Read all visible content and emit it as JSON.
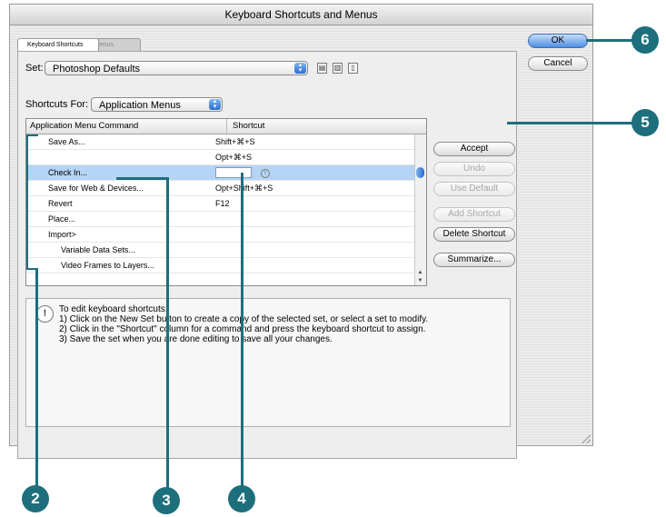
{
  "window": {
    "title": "Keyboard Shortcuts and Menus"
  },
  "tabs": [
    {
      "label": "Keyboard Shortcuts",
      "active": true
    },
    {
      "label": "Menus",
      "active": false
    }
  ],
  "set": {
    "label": "Set:",
    "value": "Photoshop Defaults"
  },
  "shortcuts_for": {
    "label": "Shortcuts For:",
    "value": "Application Menus"
  },
  "table": {
    "columns": [
      "Application Menu Command",
      "Shortcut"
    ],
    "rows": [
      {
        "command": "Save As...",
        "shortcut": "Shift+⌘+S",
        "indent": 1,
        "selected": false
      },
      {
        "command": "",
        "shortcut": "Opt+⌘+S",
        "indent": 1,
        "selected": false
      },
      {
        "command": "Check In...",
        "shortcut": "",
        "indent": 1,
        "selected": true,
        "editing": true
      },
      {
        "command": "Save for Web & Devices...",
        "shortcut": "Opt+Shift+⌘+S",
        "indent": 1,
        "selected": false
      },
      {
        "command": "Revert",
        "shortcut": "F12",
        "indent": 1,
        "selected": false
      },
      {
        "command": "Place...",
        "shortcut": "",
        "indent": 1,
        "selected": false
      },
      {
        "command": "Import>",
        "shortcut": "",
        "indent": 1,
        "selected": false
      },
      {
        "command": "Variable Data Sets...",
        "shortcut": "",
        "indent": 2,
        "selected": false
      },
      {
        "command": "Video Frames to Layers...",
        "shortcut": "",
        "indent": 2,
        "selected": false
      }
    ]
  },
  "buttons": {
    "ok": "OK",
    "cancel": "Cancel",
    "accept": "Accept",
    "undo": "Undo",
    "use_default": "Use Default",
    "add_shortcut": "Add Shortcut",
    "delete_shortcut": "Delete Shortcut",
    "summarize": "Summarize..."
  },
  "info": {
    "line1": "To edit keyboard shortcuts:",
    "line2": "1) Click on the New Set button to create a copy of the selected set, or select a set to modify.",
    "line3": "2) Click in the \"Shortcut\" column for a command and press the keyboard shortcut to assign.",
    "line4": "3) Save the set when you are done editing to save all your changes."
  },
  "callouts": [
    "2",
    "3",
    "4",
    "5",
    "6"
  ],
  "colors": {
    "callout": "#1d6f7c",
    "selection": "#b5d4f5",
    "default_button": "#4e8ee4"
  }
}
